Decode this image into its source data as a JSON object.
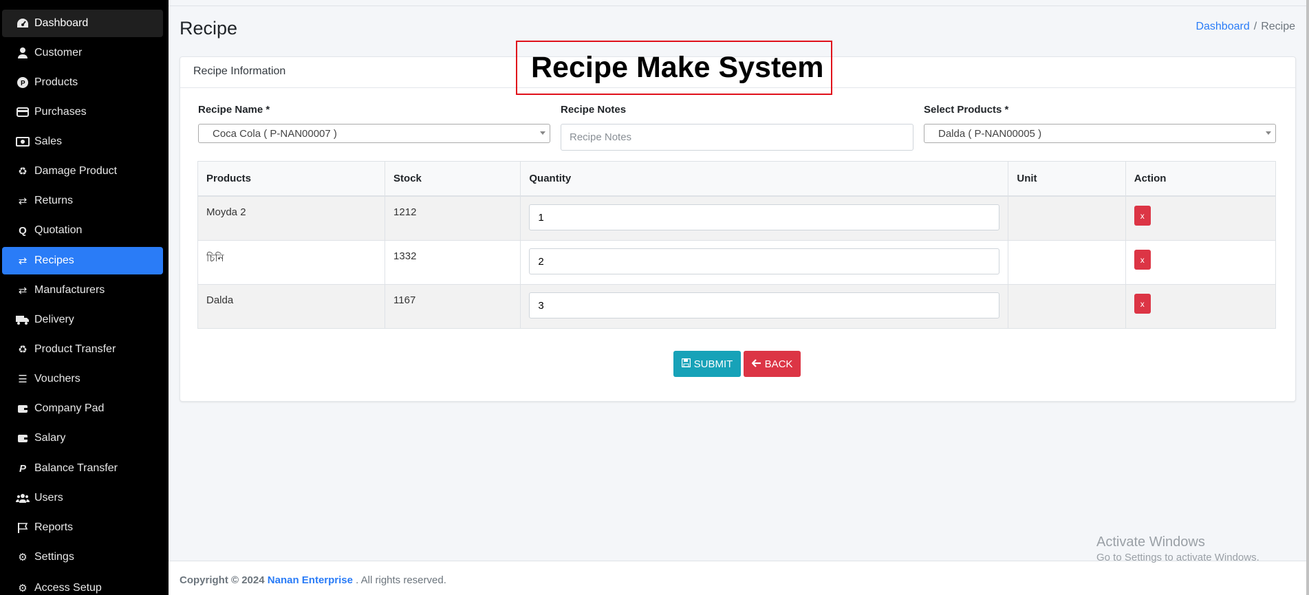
{
  "sidebar": {
    "items": [
      {
        "label": "Dashboard",
        "icon": "gauge-icon"
      },
      {
        "label": "Customer",
        "icon": "user-icon"
      },
      {
        "label": "Products",
        "icon": "product-icon"
      },
      {
        "label": "Purchases",
        "icon": "credit-card-icon"
      },
      {
        "label": "Sales",
        "icon": "money-bill-icon"
      },
      {
        "label": "Damage Product",
        "icon": "recycle-icon"
      },
      {
        "label": "Returns",
        "icon": "retweet-icon"
      },
      {
        "label": "Quotation",
        "icon": "quote-icon"
      },
      {
        "label": "Recipes",
        "icon": "retweet-icon"
      },
      {
        "label": "Manufacturers",
        "icon": "retweet-icon"
      },
      {
        "label": "Delivery",
        "icon": "truck-icon"
      },
      {
        "label": "Product Transfer",
        "icon": "recycle-icon"
      },
      {
        "label": "Vouchers",
        "icon": "list-check-icon"
      },
      {
        "label": "Company Pad",
        "icon": "wallet-icon"
      },
      {
        "label": "Salary",
        "icon": "wallet-icon"
      },
      {
        "label": "Balance Transfer",
        "icon": "paypal-icon"
      },
      {
        "label": "Users",
        "icon": "users-icon"
      },
      {
        "label": "Reports",
        "icon": "flag-icon"
      },
      {
        "label": "Settings",
        "icon": "gears-icon"
      },
      {
        "label": "Access Setup",
        "icon": "gear-icon"
      }
    ],
    "active": "Recipes"
  },
  "header": {
    "title": "Recipe",
    "breadcrumb": {
      "home": "Dashboard",
      "separator": "/",
      "current": "Recipe"
    }
  },
  "card": {
    "title": "Recipe Information"
  },
  "overlay": {
    "text": "Recipe Make System"
  },
  "form": {
    "recipe_name_label": "Recipe Name *",
    "recipe_name_value": "Coca Cola ( P-NAN00007 )",
    "recipe_notes_label": "Recipe Notes",
    "recipe_notes_placeholder": "Recipe Notes",
    "select_products_label": "Select Products *",
    "select_products_value": "Dalda ( P-NAN00005 )"
  },
  "table": {
    "headers": [
      "Products",
      "Stock",
      "Quantity",
      "Unit",
      "Action"
    ],
    "rows": [
      {
        "product": "Moyda 2",
        "stock": "1212",
        "quantity": "1",
        "unit": "",
        "action": "x"
      },
      {
        "product": "চিনি",
        "stock": "1332",
        "quantity": "2",
        "unit": "",
        "action": "x"
      },
      {
        "product": "Dalda",
        "stock": "1167",
        "quantity": "3",
        "unit": "",
        "action": "x"
      }
    ]
  },
  "buttons": {
    "submit": "SUBMIT",
    "back": "BACK"
  },
  "footer": {
    "copyright": "Copyright © 2024",
    "company": "Nanan Enterprise",
    "rest": ". All rights reserved."
  },
  "watermark": {
    "line1": "Activate Windows",
    "line2": "Go to Settings to activate Windows."
  },
  "colors": {
    "accent": "#2a7cf7",
    "danger": "#dc3545",
    "info": "#17a2b8",
    "sidebar": "#000000"
  }
}
